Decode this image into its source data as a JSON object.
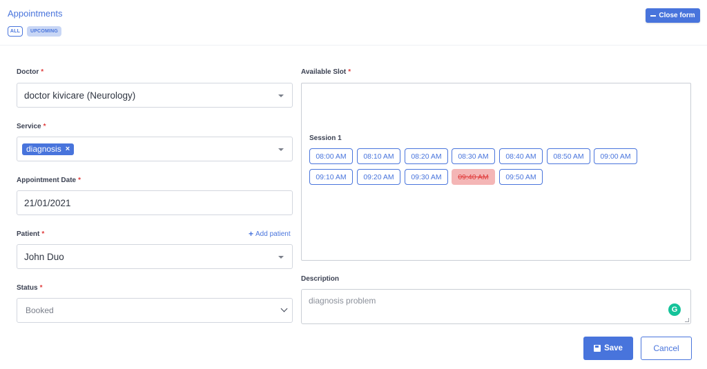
{
  "header": {
    "title": "Appointments",
    "tabs": [
      {
        "label": "ALL"
      },
      {
        "label": "UPCOMING"
      }
    ],
    "close_form_label": "Close form"
  },
  "form": {
    "required_mark": "*",
    "doctor": {
      "label": "Doctor",
      "value": "doctor kivicare (Neurology)"
    },
    "service": {
      "label": "Service",
      "chip": "diagnosis",
      "chip_remove": "×"
    },
    "appointment_date": {
      "label": "Appointment Date",
      "value": "21/01/2021"
    },
    "patient": {
      "label": "Patient",
      "value": "John Duo",
      "add_label": "Add patient"
    },
    "status": {
      "label": "Status",
      "value": "Booked"
    },
    "available_slot": {
      "label": "Available Slot",
      "session_label": "Session 1",
      "slots": [
        {
          "time": "08:00 AM",
          "booked": false
        },
        {
          "time": "08:10 AM",
          "booked": false
        },
        {
          "time": "08:20 AM",
          "booked": false
        },
        {
          "time": "08:30 AM",
          "booked": false
        },
        {
          "time": "08:40 AM",
          "booked": false
        },
        {
          "time": "08:50 AM",
          "booked": false
        },
        {
          "time": "09:00 AM",
          "booked": false
        },
        {
          "time": "09:10 AM",
          "booked": false
        },
        {
          "time": "09:20 AM",
          "booked": false
        },
        {
          "time": "09:30 AM",
          "booked": false
        },
        {
          "time": "09:40 AM",
          "booked": true
        },
        {
          "time": "09:50 AM",
          "booked": false
        }
      ]
    },
    "description": {
      "label": "Description",
      "value": "diagnosis problem"
    }
  },
  "actions": {
    "save_label": "Save",
    "cancel_label": "Cancel"
  },
  "colors": {
    "accent": "#4874dc",
    "required": "#e03c3c",
    "booked_bg": "#f4b6b6",
    "grammarly": "#15c39a"
  }
}
